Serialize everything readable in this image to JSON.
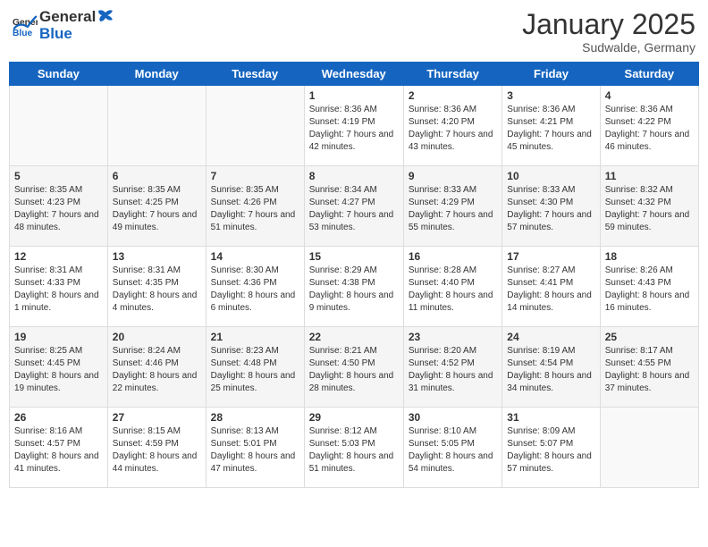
{
  "header": {
    "logo_general": "General",
    "logo_blue": "Blue",
    "title": "January 2025",
    "subtitle": "Sudwalde, Germany"
  },
  "weekdays": [
    "Sunday",
    "Monday",
    "Tuesday",
    "Wednesday",
    "Thursday",
    "Friday",
    "Saturday"
  ],
  "weeks": [
    [
      {
        "day": "",
        "sunrise": "",
        "sunset": "",
        "daylight": "",
        "empty": true
      },
      {
        "day": "",
        "sunrise": "",
        "sunset": "",
        "daylight": "",
        "empty": true
      },
      {
        "day": "",
        "sunrise": "",
        "sunset": "",
        "daylight": "",
        "empty": true
      },
      {
        "day": "1",
        "sunrise": "Sunrise: 8:36 AM",
        "sunset": "Sunset: 4:19 PM",
        "daylight": "Daylight: 7 hours and 42 minutes."
      },
      {
        "day": "2",
        "sunrise": "Sunrise: 8:36 AM",
        "sunset": "Sunset: 4:20 PM",
        "daylight": "Daylight: 7 hours and 43 minutes."
      },
      {
        "day": "3",
        "sunrise": "Sunrise: 8:36 AM",
        "sunset": "Sunset: 4:21 PM",
        "daylight": "Daylight: 7 hours and 45 minutes."
      },
      {
        "day": "4",
        "sunrise": "Sunrise: 8:36 AM",
        "sunset": "Sunset: 4:22 PM",
        "daylight": "Daylight: 7 hours and 46 minutes."
      }
    ],
    [
      {
        "day": "5",
        "sunrise": "Sunrise: 8:35 AM",
        "sunset": "Sunset: 4:23 PM",
        "daylight": "Daylight: 7 hours and 48 minutes."
      },
      {
        "day": "6",
        "sunrise": "Sunrise: 8:35 AM",
        "sunset": "Sunset: 4:25 PM",
        "daylight": "Daylight: 7 hours and 49 minutes."
      },
      {
        "day": "7",
        "sunrise": "Sunrise: 8:35 AM",
        "sunset": "Sunset: 4:26 PM",
        "daylight": "Daylight: 7 hours and 51 minutes."
      },
      {
        "day": "8",
        "sunrise": "Sunrise: 8:34 AM",
        "sunset": "Sunset: 4:27 PM",
        "daylight": "Daylight: 7 hours and 53 minutes."
      },
      {
        "day": "9",
        "sunrise": "Sunrise: 8:33 AM",
        "sunset": "Sunset: 4:29 PM",
        "daylight": "Daylight: 7 hours and 55 minutes."
      },
      {
        "day": "10",
        "sunrise": "Sunrise: 8:33 AM",
        "sunset": "Sunset: 4:30 PM",
        "daylight": "Daylight: 7 hours and 57 minutes."
      },
      {
        "day": "11",
        "sunrise": "Sunrise: 8:32 AM",
        "sunset": "Sunset: 4:32 PM",
        "daylight": "Daylight: 7 hours and 59 minutes."
      }
    ],
    [
      {
        "day": "12",
        "sunrise": "Sunrise: 8:31 AM",
        "sunset": "Sunset: 4:33 PM",
        "daylight": "Daylight: 8 hours and 1 minute."
      },
      {
        "day": "13",
        "sunrise": "Sunrise: 8:31 AM",
        "sunset": "Sunset: 4:35 PM",
        "daylight": "Daylight: 8 hours and 4 minutes."
      },
      {
        "day": "14",
        "sunrise": "Sunrise: 8:30 AM",
        "sunset": "Sunset: 4:36 PM",
        "daylight": "Daylight: 8 hours and 6 minutes."
      },
      {
        "day": "15",
        "sunrise": "Sunrise: 8:29 AM",
        "sunset": "Sunset: 4:38 PM",
        "daylight": "Daylight: 8 hours and 9 minutes."
      },
      {
        "day": "16",
        "sunrise": "Sunrise: 8:28 AM",
        "sunset": "Sunset: 4:40 PM",
        "daylight": "Daylight: 8 hours and 11 minutes."
      },
      {
        "day": "17",
        "sunrise": "Sunrise: 8:27 AM",
        "sunset": "Sunset: 4:41 PM",
        "daylight": "Daylight: 8 hours and 14 minutes."
      },
      {
        "day": "18",
        "sunrise": "Sunrise: 8:26 AM",
        "sunset": "Sunset: 4:43 PM",
        "daylight": "Daylight: 8 hours and 16 minutes."
      }
    ],
    [
      {
        "day": "19",
        "sunrise": "Sunrise: 8:25 AM",
        "sunset": "Sunset: 4:45 PM",
        "daylight": "Daylight: 8 hours and 19 minutes."
      },
      {
        "day": "20",
        "sunrise": "Sunrise: 8:24 AM",
        "sunset": "Sunset: 4:46 PM",
        "daylight": "Daylight: 8 hours and 22 minutes."
      },
      {
        "day": "21",
        "sunrise": "Sunrise: 8:23 AM",
        "sunset": "Sunset: 4:48 PM",
        "daylight": "Daylight: 8 hours and 25 minutes."
      },
      {
        "day": "22",
        "sunrise": "Sunrise: 8:21 AM",
        "sunset": "Sunset: 4:50 PM",
        "daylight": "Daylight: 8 hours and 28 minutes."
      },
      {
        "day": "23",
        "sunrise": "Sunrise: 8:20 AM",
        "sunset": "Sunset: 4:52 PM",
        "daylight": "Daylight: 8 hours and 31 minutes."
      },
      {
        "day": "24",
        "sunrise": "Sunrise: 8:19 AM",
        "sunset": "Sunset: 4:54 PM",
        "daylight": "Daylight: 8 hours and 34 minutes."
      },
      {
        "day": "25",
        "sunrise": "Sunrise: 8:17 AM",
        "sunset": "Sunset: 4:55 PM",
        "daylight": "Daylight: 8 hours and 37 minutes."
      }
    ],
    [
      {
        "day": "26",
        "sunrise": "Sunrise: 8:16 AM",
        "sunset": "Sunset: 4:57 PM",
        "daylight": "Daylight: 8 hours and 41 minutes."
      },
      {
        "day": "27",
        "sunrise": "Sunrise: 8:15 AM",
        "sunset": "Sunset: 4:59 PM",
        "daylight": "Daylight: 8 hours and 44 minutes."
      },
      {
        "day": "28",
        "sunrise": "Sunrise: 8:13 AM",
        "sunset": "Sunset: 5:01 PM",
        "daylight": "Daylight: 8 hours and 47 minutes."
      },
      {
        "day": "29",
        "sunrise": "Sunrise: 8:12 AM",
        "sunset": "Sunset: 5:03 PM",
        "daylight": "Daylight: 8 hours and 51 minutes."
      },
      {
        "day": "30",
        "sunrise": "Sunrise: 8:10 AM",
        "sunset": "Sunset: 5:05 PM",
        "daylight": "Daylight: 8 hours and 54 minutes."
      },
      {
        "day": "31",
        "sunrise": "Sunrise: 8:09 AM",
        "sunset": "Sunset: 5:07 PM",
        "daylight": "Daylight: 8 hours and 57 minutes."
      },
      {
        "day": "",
        "sunrise": "",
        "sunset": "",
        "daylight": "",
        "empty": true
      }
    ]
  ]
}
